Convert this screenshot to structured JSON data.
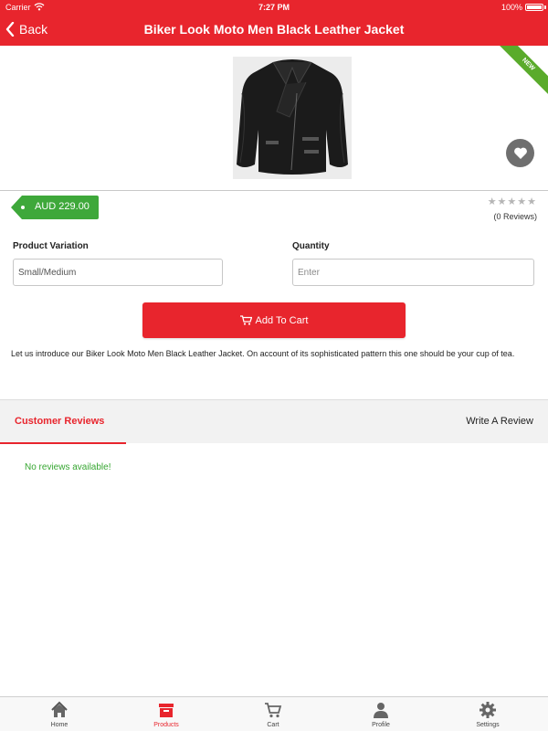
{
  "status_bar": {
    "carrier": "Carrier",
    "time": "7:27 PM",
    "battery": "100%"
  },
  "header": {
    "back_label": "Back",
    "title": "Biker Look Moto Men Black Leather Jacket"
  },
  "product": {
    "badge": "NEW",
    "price": "AUD 229.00",
    "rating_stars": "★★★★★",
    "rating": 0,
    "reviews_count_label": "(0 Reviews)",
    "description": "Let us introduce our Biker Look Moto Men Black Leather Jacket. On account of its sophisticated pattern this one should be your cup of tea."
  },
  "form": {
    "variation_label": "Product Variation",
    "variation_value": "Small/Medium",
    "quantity_label": "Quantity",
    "quantity_placeholder": "Enter",
    "add_to_cart_label": "Add To Cart"
  },
  "reviews": {
    "tab_label": "Customer Reviews",
    "write_label": "Write A Review",
    "empty_message": "No reviews available!"
  },
  "tabbar": {
    "items": [
      {
        "label": "Home",
        "icon": "home-icon"
      },
      {
        "label": "Products",
        "icon": "products-icon",
        "active": true
      },
      {
        "label": "Cart",
        "icon": "cart-icon"
      },
      {
        "label": "Profile",
        "icon": "profile-icon"
      },
      {
        "label": "Settings",
        "icon": "settings-icon"
      }
    ]
  },
  "colors": {
    "accent": "#e8252d",
    "price_tag": "#3ea83a",
    "new_badge": "#5aab2b",
    "success_text": "#36a631"
  }
}
